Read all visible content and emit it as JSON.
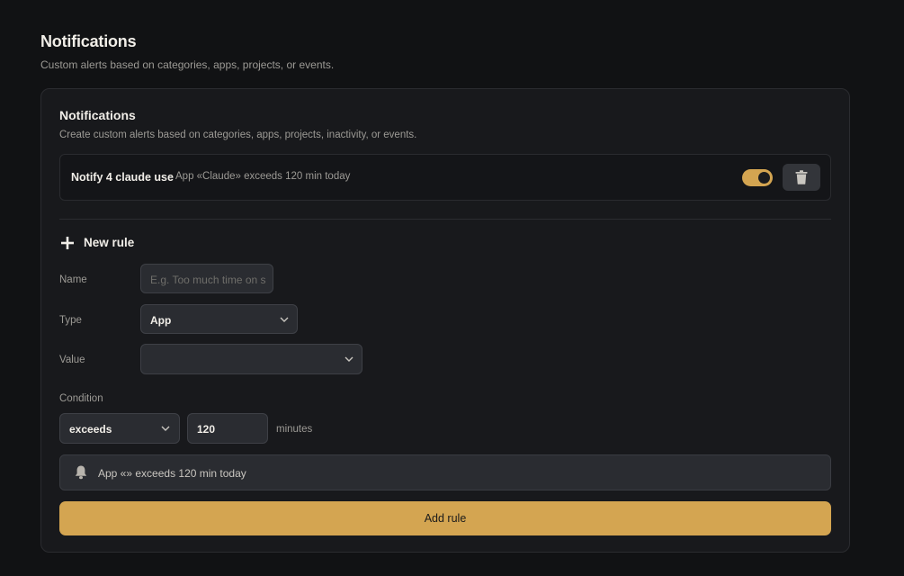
{
  "header": {
    "title": "Notifications",
    "subtitle": "Custom alerts based on categories, apps, projects, or events."
  },
  "card": {
    "title": "Notifications",
    "subtitle": "Create custom alerts based on categories, apps, projects, inactivity, or events."
  },
  "rules": [
    {
      "name": "Notify 4 claude use",
      "description": "App «Claude» exceeds 120 min today",
      "enabled": true
    }
  ],
  "new_rule": {
    "heading": "New rule",
    "name_label": "Name",
    "name_placeholder": "E.g. Too much time on s",
    "type_label": "Type",
    "type_value": "App",
    "value_label": "Value",
    "value_value": "",
    "condition_label": "Condition",
    "condition_value": "exceeds",
    "amount_value": "120",
    "unit_label": "minutes",
    "preview_text": "App «» exceeds 120 min today",
    "submit_label": "Add rule"
  },
  "icons": {
    "add": "plus-icon",
    "delete": "trash-icon",
    "preview": "bell-icon",
    "dropdown": "chevron-down-icon"
  },
  "colors": {
    "background": "#111214",
    "card": "#18191c",
    "accent": "#d4a551",
    "muted_text": "#9c9a95"
  }
}
